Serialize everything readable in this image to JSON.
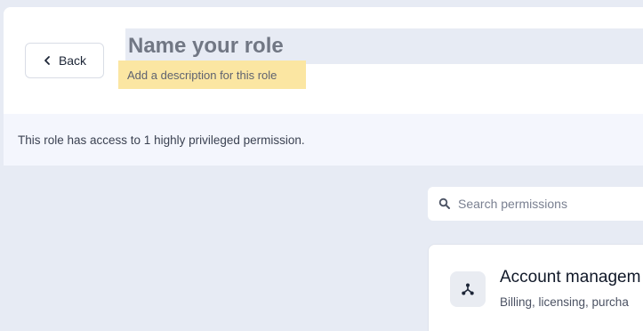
{
  "header": {
    "back_label": "Back",
    "role_name_placeholder": "Name your role",
    "role_description_placeholder": "Add a description for this role"
  },
  "banner": {
    "text": "This role has access to 1 highly privileged permission."
  },
  "search": {
    "placeholder": "Search permissions",
    "icon": "search-icon"
  },
  "permission_group": {
    "title": "Account managem",
    "subtitle": "Billing, licensing, purcha",
    "icon": "hierarchy-icon"
  },
  "colors": {
    "page_bg": "#e7ebf4",
    "highlight": "#fbe6a2",
    "banner_bg": "#f4f6fd",
    "text_dark": "#101828"
  }
}
